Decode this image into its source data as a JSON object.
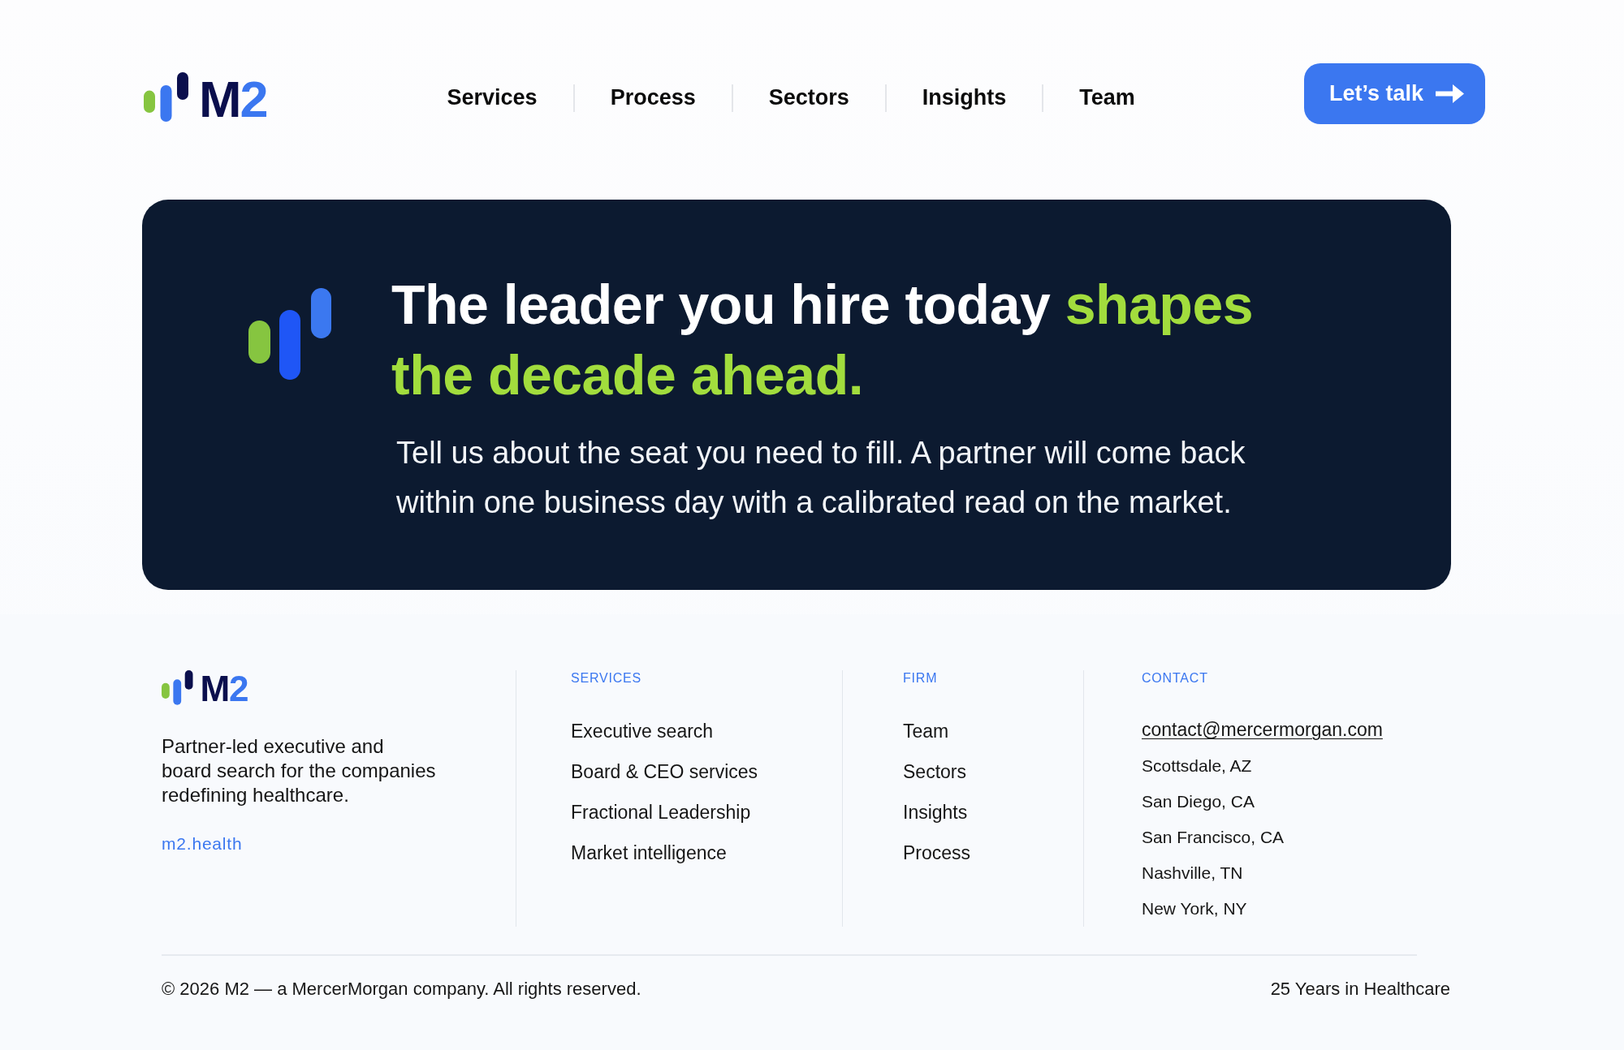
{
  "header": {
    "logo": {
      "wordmark": "M",
      "wordmark_accent": "2"
    },
    "nav": [
      {
        "label": "Services"
      },
      {
        "label": "Process"
      },
      {
        "label": "Sectors"
      },
      {
        "label": "Insights"
      },
      {
        "label": "Team"
      }
    ],
    "cta": {
      "label": "Let’s talk"
    }
  },
  "hero": {
    "heading": {
      "text": "The leader you hire today",
      "highlight": "shapes the decade ahead."
    },
    "body": "Tell us about the seat you need to fill. A partner will come back within one business day with a calibrated read on the market."
  },
  "footer": {
    "logo": {
      "wordmark": "M",
      "wordmark_accent": "2"
    },
    "description_lines": [
      "Partner-led executive and",
      "board search for the companies",
      "redefining healthcare."
    ],
    "website": "m2.health",
    "columns": [
      {
        "heading": "SERVICES",
        "links": [
          "Executive search",
          "Board & CEO services",
          "Fractional Leadership",
          "Market intelligence"
        ]
      },
      {
        "heading": "FIRM",
        "links": [
          "Team",
          "Sectors",
          "Insights",
          "Process"
        ]
      }
    ],
    "contact": {
      "heading": "CONTACT",
      "email": "contact@mercermorgan.com",
      "locations": [
        "Scottsdale, AZ",
        "San Diego, CA",
        "San Francisco, CA",
        "Nashville, TN",
        "New York, NY"
      ]
    },
    "copyright": "© 2026 M2 — a MercerMorgan company. All rights reserved.",
    "tagline": "25 Years in Healthcare"
  }
}
